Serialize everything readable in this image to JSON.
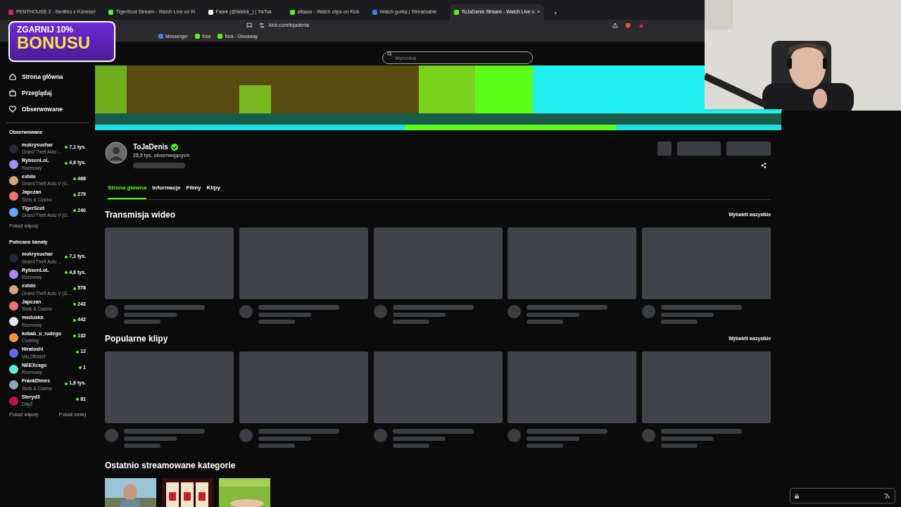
{
  "browser": {
    "tabs": [
      {
        "title": "PENTHOUSE 2 - Sentino x Koneser",
        "color": "#e0245e",
        "selected": false
      },
      {
        "title": "TigerScot Stream - Watch Live on Ki",
        "color": "#53fc18",
        "selected": false
      },
      {
        "title": "Fatek (@fatekk_) | TikTok",
        "color": "#ffffff",
        "selected": false
      },
      {
        "title": "altaaar - Watch clips on Kick",
        "color": "#53fc18",
        "selected": false
      },
      {
        "title": "Watch gorka | Streamable",
        "color": "#3b82f6",
        "selected": false
      },
      {
        "title": "ToJaDenis Stream - Watch Live o",
        "color": "#53fc18",
        "selected": true
      }
    ],
    "new_tab": "+",
    "close": "×",
    "url": "kick.com/tojadenis",
    "bookmarks": [
      {
        "title": "Messenger",
        "color": "#3b82f6"
      },
      {
        "title": "Kick",
        "color": "#53fc18"
      },
      {
        "title": "Kick - Giveaway",
        "color": "#53fc18"
      }
    ]
  },
  "overlay_badge": {
    "line1": "ZGARNIJ 10%",
    "line2": "BONUSU"
  },
  "search": {
    "placeholder": "Wyszukaj"
  },
  "nav": [
    {
      "label": "Strona główna"
    },
    {
      "label": "Przeglądaj"
    },
    {
      "label": "Obserwowane"
    }
  ],
  "followed": {
    "title": "Obserwowane",
    "more": "Pokaż więcej",
    "channels": [
      {
        "name": "mokrysuchar",
        "category": "Grand Theft Auto ...",
        "viewers": "7,1 tys.",
        "color": "#1f2937"
      },
      {
        "name": "RybsonLoL",
        "category": "Rozmowy",
        "viewers": "4,6 tys.",
        "color": "#a78bfa"
      },
      {
        "name": "exhiie",
        "category": "Grand Theft Auto V (G...",
        "viewers": "468",
        "color": "#d6a77a"
      },
      {
        "name": "Japczan",
        "category": "Slots & Casino",
        "viewers": "279",
        "color": "#f87171"
      },
      {
        "name": "TigerScot",
        "category": "Grand Theft Auto V (G...",
        "viewers": "240",
        "color": "#60a5fa"
      }
    ]
  },
  "recommended": {
    "title": "Polecane kanały",
    "more": "Pokaż więcej",
    "less": "Pokaż mniej",
    "channels": [
      {
        "name": "mokrysuchar",
        "category": "Grand Theft Auto ...",
        "viewers": "7,1 tys.",
        "color": "#1f2937"
      },
      {
        "name": "RybsonLoL",
        "category": "Rozmowy",
        "viewers": "4,6 tys.",
        "color": "#a78bfa"
      },
      {
        "name": "exhiie",
        "category": "Grand Theft Auto V (G...",
        "viewers": "578",
        "color": "#d6a77a"
      },
      {
        "name": "Japczan",
        "category": "Slots & Casino",
        "viewers": "243",
        "color": "#f87171"
      },
      {
        "name": "meduska",
        "category": "Rozmowy",
        "viewers": "442",
        "color": "#e5e7eb"
      },
      {
        "name": "kebab_u_rudego",
        "category": "Cooking",
        "viewers": "132",
        "color": "#fb923c"
      },
      {
        "name": "Hiratoshi",
        "category": "VALORANT",
        "viewers": "12",
        "color": "#6366f1"
      },
      {
        "name": "NEEXcsgo",
        "category": "Rozmowy",
        "viewers": "1",
        "color": "#5eead4"
      },
      {
        "name": "FrankDimes",
        "category": "Slots & Casino",
        "viewers": "1,6 tys.",
        "color": "#94a3b8"
      },
      {
        "name": "Steryd3",
        "category": "DayZ",
        "viewers": "81",
        "color": "#be123c"
      }
    ]
  },
  "channel": {
    "name": "ToJaDenis",
    "verified": true,
    "followers": "25,5 tys. obserwujących"
  },
  "profile_tabs": [
    {
      "label": "Strona główna",
      "selected": true
    },
    {
      "label": "Informacje",
      "selected": false
    },
    {
      "label": "Filmy",
      "selected": false
    },
    {
      "label": "Klipy",
      "selected": false
    }
  ],
  "sections": [
    {
      "title": "Transmisja wideo",
      "link": "Wyświetl wszystkie"
    },
    {
      "title": "Popularne klipy",
      "link": "Wyświetl wszystkie"
    }
  ],
  "categories": {
    "title": "Ostatnio streamowane kategorie"
  }
}
